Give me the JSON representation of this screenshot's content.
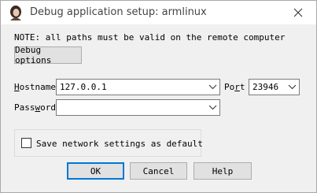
{
  "window": {
    "title": "Debug application setup: armlinux",
    "app_icon": "avatar-icon",
    "close_icon": "close-icon"
  },
  "note": "NOTE: all paths must be valid on the remote computer",
  "debug_options_label": "Debug options",
  "hostname": {
    "label_pre": "",
    "label_accel": "H",
    "label_post": "ostname",
    "value": "127.0.0.1"
  },
  "port": {
    "label_pre": "Po",
    "label_accel": "r",
    "label_post": "t",
    "value": "23946"
  },
  "password": {
    "label_pre": "Pass",
    "label_accel": "w",
    "label_post": "ord",
    "value": ""
  },
  "save_settings": {
    "label": "Save network settings as default",
    "checked": false
  },
  "buttons": {
    "ok": "OK",
    "cancel": "Cancel",
    "help": "Help"
  },
  "colors": {
    "focus_border": "#0078d7",
    "window_bg": "#f0f0f0"
  }
}
